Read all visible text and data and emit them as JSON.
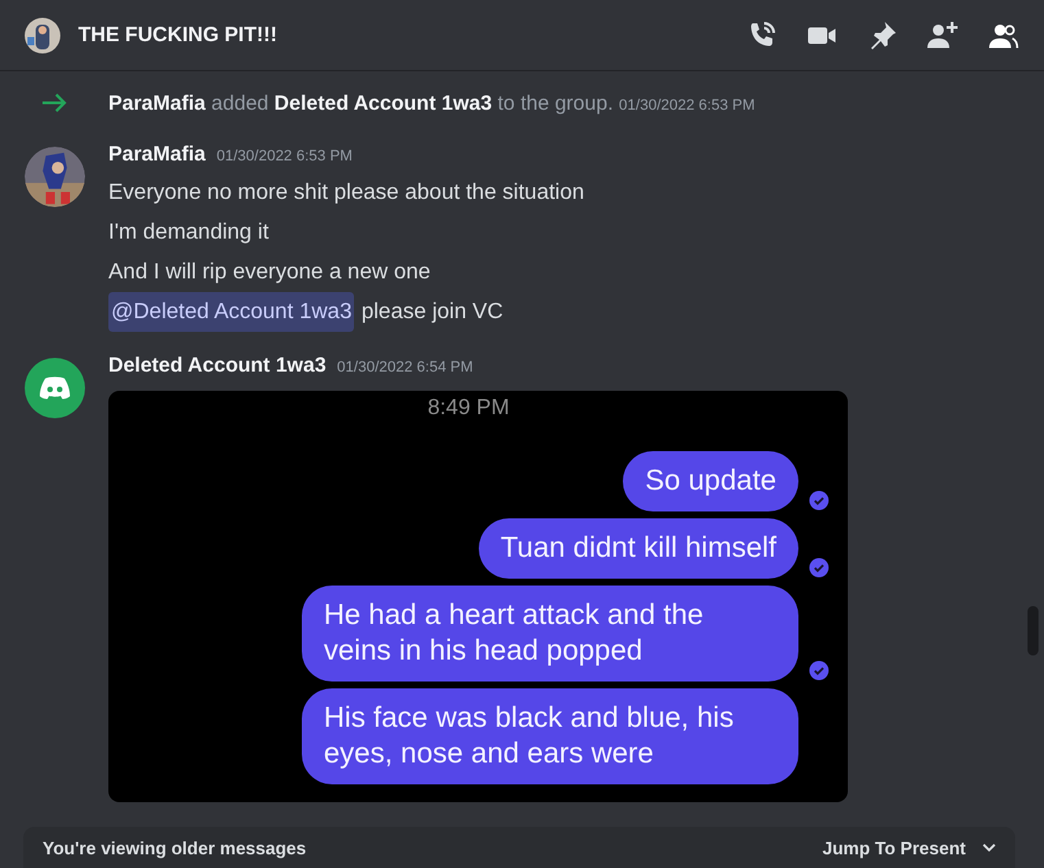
{
  "channel": {
    "title": "THE FUCKING PIT!!!"
  },
  "system_message": {
    "actor": "ParaMafia",
    "action": "added",
    "target": "Deleted Account 1wa3",
    "suffix": "to the group.",
    "timestamp": "01/30/2022 6:53 PM"
  },
  "messages": [
    {
      "author": "ParaMafia",
      "timestamp": "01/30/2022 6:53 PM",
      "lines": [
        {
          "kind": "text",
          "text": "Everyone no more shit please about the situation"
        },
        {
          "kind": "text",
          "text": "I'm demanding it"
        },
        {
          "kind": "text",
          "text": "And I will rip everyone a new one"
        },
        {
          "kind": "mention",
          "mention": "@Deleted Account 1wa3",
          "text": "please join VC"
        }
      ]
    },
    {
      "author": "Deleted Account 1wa3",
      "timestamp": "01/30/2022 6:54 PM",
      "attachment": {
        "time": "8:49 PM",
        "bubbles": [
          {
            "text": "So update",
            "read": true
          },
          {
            "text": "Tuan didnt kill himself",
            "read": true
          },
          {
            "text": "He had a heart attack and the veins in his head popped",
            "read": true
          },
          {
            "text": "His face was black and blue, his eyes, nose and ears were",
            "read": false
          }
        ]
      }
    }
  ],
  "banner": {
    "text": "You're viewing older messages",
    "action": "Jump To Present"
  }
}
